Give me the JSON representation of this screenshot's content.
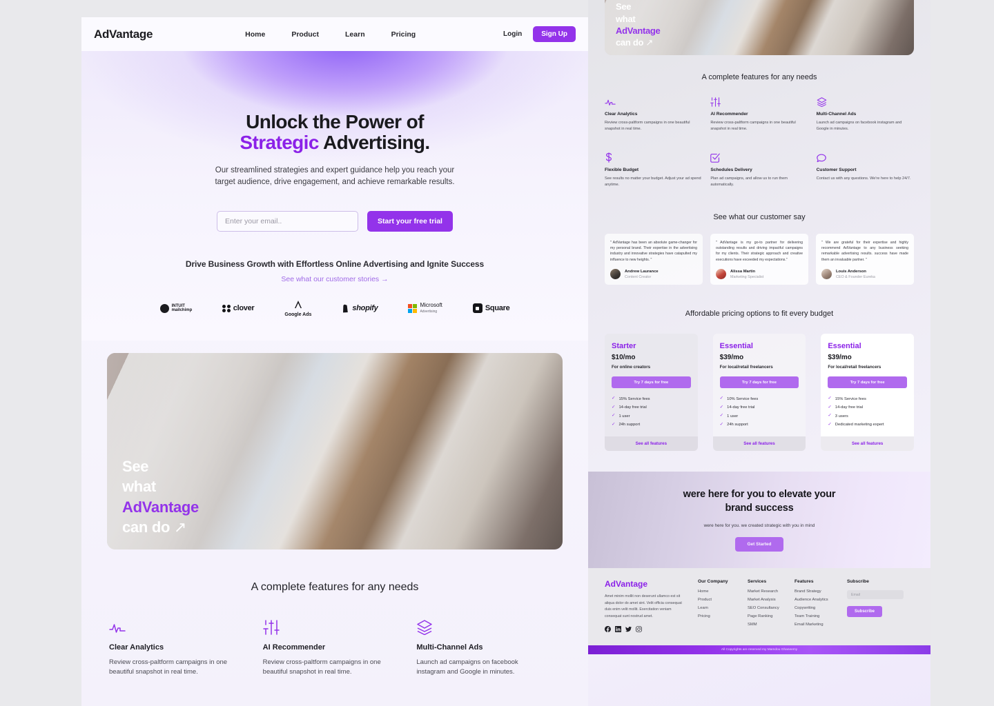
{
  "nav": {
    "brand": "AdVantage",
    "links": [
      "Home",
      "Product",
      "Learn",
      "Pricing"
    ],
    "login_label": "Login",
    "signup_label": "Sign Up"
  },
  "hero": {
    "title_line1": "Unlock the Power of",
    "title_accent": "Strategic",
    "title_rest": " Advertising.",
    "subtitle": "Our streamlined strategies and expert guidance help you reach your target audience, drive engagement, and achieve remarkable results.",
    "email_placeholder": "Enter your email..",
    "email_value": "",
    "cta_label": "Start your free trial",
    "growth_line": "Drive Business Growth with Effortless Online Advertising and Ignite Success",
    "stories_link": "See what our customer stories →"
  },
  "logos": [
    {
      "name": "intuit mailchimp",
      "line1": "INTUIT",
      "line2": "mailchimp"
    },
    {
      "name": "clover",
      "label": "clover"
    },
    {
      "name": "Google Ads",
      "label": "Google Ads"
    },
    {
      "name": "shopify",
      "label": "shopify"
    },
    {
      "name": "Microsoft Advertising",
      "line1": "Microsoft",
      "line2": "Advertising"
    },
    {
      "name": "Square",
      "label": "Square"
    }
  ],
  "promo": {
    "line1": "See",
    "line2": "what",
    "line3": "AdVantage",
    "line4": "can do",
    "arrow": "↗"
  },
  "features": {
    "heading": "A complete features for any needs",
    "items": [
      {
        "icon": "pulse-icon",
        "title": "Clear Analytics",
        "desc": "Review cross-paltform campaigns in one beautiful snapshot in real time."
      },
      {
        "icon": "sliders-icon",
        "title": "AI Recommender",
        "desc": "Review cross-paltform campaigns in one beautiful snapshot in real time."
      },
      {
        "icon": "layers-icon",
        "title": "Multi-Channel Ads",
        "desc": "Launch ad campaigns on facebook instagram and Google in minutes."
      },
      {
        "icon": "dollar-icon",
        "title": "Flexible Budget",
        "desc": "See results no matter your budget. Adjust your ad spend anytime."
      },
      {
        "icon": "check-square-icon",
        "title": "Schedules Delivery",
        "desc": "Plan ad campaigns, and allow us to run them automatically."
      },
      {
        "icon": "chat-icon",
        "title": "Customer Support",
        "desc": "Contact us with any questions. We're here to help 24/7."
      }
    ]
  },
  "testimonials": {
    "heading": "See what our customer say",
    "items": [
      {
        "quote": "\" AdVantage has been an absolute game-changer for my personal brand. Their expertise in the advertising industry and innovative strategies have catapulted my influence to new heights. \"",
        "name": "Andrew Laurance",
        "role": "Content Creator"
      },
      {
        "quote": "\" AdVantage is my go-to partner for delivering outstanding results and driving impactful campaigns for my clients. Their strategic approach and creative executions have exceeded my expectations.\"",
        "name": "Alissa Martin",
        "role": "Marketing Specialist"
      },
      {
        "quote": "\" We are grateful for their expertise and highly recommend AdVantage to any business seeking remarkable advertising results. success have made them an invaluable partner. \"",
        "name": "Louis Anderson",
        "role": "CEO & Founder Eureka"
      }
    ]
  },
  "pricing": {
    "heading": "Affordable pricing options to fit every budget",
    "plans": [
      {
        "name": "Starter",
        "price": "$10/mo",
        "for": "For online creators",
        "cta": "Try 7 days for free",
        "features": [
          "15% Service fees",
          "14-day free trial",
          "1 user",
          "24h support"
        ],
        "footer": "See all features"
      },
      {
        "name": "Essential",
        "price": "$39/mo",
        "for": "For local/retail freelancers",
        "cta": "Try 7 days for free",
        "features": [
          "10% Service fees",
          "14-day free trial",
          "1 user",
          "24h support"
        ],
        "footer": "See all features"
      },
      {
        "name": "Essential",
        "price": "$39/mo",
        "for": "For local/retail freelancers",
        "cta": "Try 7 days for free",
        "features": [
          "15% Service fees",
          "14-day free trial",
          "3 users",
          "Dedicated marketing expert"
        ],
        "footer": "See all features"
      }
    ]
  },
  "cta": {
    "title_l1": "were here for you to elevate your",
    "title_l2": "brand success",
    "subtitle": "were here for you. we created strategic with you in mind",
    "button": "Get Started"
  },
  "footer": {
    "brand": "AdVantage",
    "desc": "Amet minim mollit non deserunt ullamco est sit aliqua dolor do amet sint. Velit officia consequat duis enim velit mollit. Exercitation veniam consequat sunt nostrud amet.",
    "socials": [
      "facebook-icon",
      "linkedin-icon",
      "twitter-icon",
      "instagram-icon"
    ],
    "columns": [
      {
        "title": "Our Company",
        "links": [
          "Home",
          "Product",
          "Learn",
          "Pricing"
        ]
      },
      {
        "title": "Services",
        "links": [
          "Market Research",
          "Market Analysis",
          "SEO Consultancy",
          "Page Ranking",
          "SMM"
        ]
      },
      {
        "title": "Features",
        "links": [
          "Brand  Strategy",
          "Audience Analytics",
          "Copywriting",
          "Team Training",
          "Email Marketing"
        ]
      }
    ],
    "subscribe_title": "Subscribe",
    "subscribe_placeholder": "Email",
    "subscribe_value": "",
    "subscribe_button": "Subscribe",
    "copyright": "All Copyrights are reserved my Mamdou Ghaneemy"
  },
  "colors": {
    "accent": "#9333ea",
    "accent_light": "#b06aee",
    "accent_deep": "#8b21e8"
  }
}
